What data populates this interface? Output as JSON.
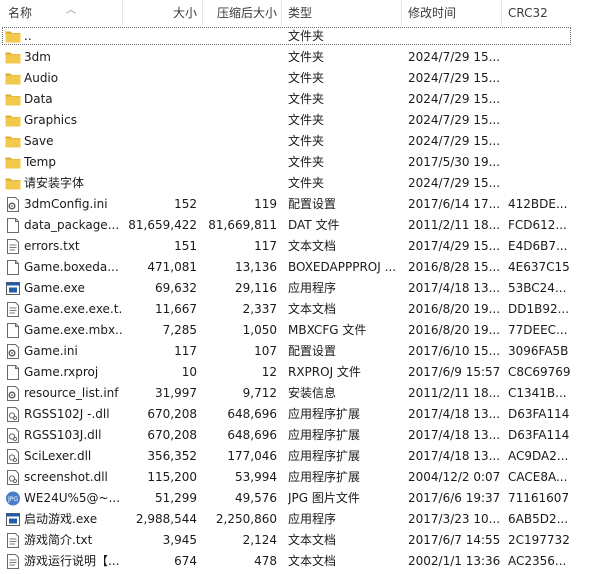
{
  "columns": {
    "name": "名称",
    "size": "大小",
    "compressed": "压缩后大小",
    "type": "类型",
    "modified": "修改时间",
    "crc": "CRC32"
  },
  "rows": [
    {
      "name": "..",
      "size": "",
      "csize": "",
      "type": "文件夹",
      "mod": "",
      "crc": "",
      "icon": "folder-icon"
    },
    {
      "name": "3dm",
      "size": "",
      "csize": "",
      "type": "文件夹",
      "mod": "2024/7/29 15...",
      "crc": "",
      "icon": "folder-icon"
    },
    {
      "name": "Audio",
      "size": "",
      "csize": "",
      "type": "文件夹",
      "mod": "2024/7/29 15...",
      "crc": "",
      "icon": "folder-icon"
    },
    {
      "name": "Data",
      "size": "",
      "csize": "",
      "type": "文件夹",
      "mod": "2024/7/29 15...",
      "crc": "",
      "icon": "folder-icon"
    },
    {
      "name": "Graphics",
      "size": "",
      "csize": "",
      "type": "文件夹",
      "mod": "2024/7/29 15...",
      "crc": "",
      "icon": "folder-icon"
    },
    {
      "name": "Save",
      "size": "",
      "csize": "",
      "type": "文件夹",
      "mod": "2024/7/29 15...",
      "crc": "",
      "icon": "folder-icon"
    },
    {
      "name": "Temp",
      "size": "",
      "csize": "",
      "type": "文件夹",
      "mod": "2017/5/30 19...",
      "crc": "",
      "icon": "folder-icon"
    },
    {
      "name": "请安装字体",
      "size": "",
      "csize": "",
      "type": "文件夹",
      "mod": "2024/7/29 15...",
      "crc": "",
      "icon": "folder-icon"
    },
    {
      "name": "3dmConfig.ini",
      "size": "152",
      "csize": "119",
      "type": "配置设置",
      "mod": "2017/6/14 17...",
      "crc": "412BDE...",
      "icon": "settings-file-icon"
    },
    {
      "name": "data_package...",
      "size": "81,659,422",
      "csize": "81,669,811",
      "type": "DAT 文件",
      "mod": "2011/2/11 18...",
      "crc": "FCD612...",
      "icon": "file-icon"
    },
    {
      "name": "errors.txt",
      "size": "151",
      "csize": "117",
      "type": "文本文档",
      "mod": "2017/4/29 15...",
      "crc": "E4D6B7...",
      "icon": "text-file-icon"
    },
    {
      "name": "Game.boxeda...",
      "size": "471,081",
      "csize": "13,136",
      "type": "BOXEDAPPPROJ ...",
      "mod": "2016/8/28 15...",
      "crc": "4E637C15",
      "icon": "file-icon"
    },
    {
      "name": "Game.exe",
      "size": "69,632",
      "csize": "29,116",
      "type": "应用程序",
      "mod": "2017/4/18 13...",
      "crc": "53BC24...",
      "icon": "exe-icon"
    },
    {
      "name": "Game.exe.exe.t...",
      "size": "11,667",
      "csize": "2,337",
      "type": "文本文档",
      "mod": "2016/8/20 19...",
      "crc": "DD1B92...",
      "icon": "text-file-icon"
    },
    {
      "name": "Game.exe.mbx...",
      "size": "7,285",
      "csize": "1,050",
      "type": "MBXCFG 文件",
      "mod": "2016/8/20 19...",
      "crc": "77DEEC...",
      "icon": "file-icon"
    },
    {
      "name": "Game.ini",
      "size": "117",
      "csize": "107",
      "type": "配置设置",
      "mod": "2017/6/10 15...",
      "crc": "3096FA5B",
      "icon": "settings-file-icon"
    },
    {
      "name": "Game.rxproj",
      "size": "10",
      "csize": "12",
      "type": "RXPROJ 文件",
      "mod": "2017/6/9 15:57",
      "crc": "C8C69769",
      "icon": "file-icon"
    },
    {
      "name": "resource_list.inf",
      "size": "31,997",
      "csize": "9,712",
      "type": "安装信息",
      "mod": "2011/2/11 18...",
      "crc": "C1341B...",
      "icon": "settings-file-icon"
    },
    {
      "name": "RGSS102J -.dll",
      "size": "670,208",
      "csize": "648,696",
      "type": "应用程序扩展",
      "mod": "2017/4/18 13...",
      "crc": "D63FA114",
      "icon": "dll-icon"
    },
    {
      "name": "RGSS103J.dll",
      "size": "670,208",
      "csize": "648,696",
      "type": "应用程序扩展",
      "mod": "2017/4/18 13...",
      "crc": "D63FA114",
      "icon": "dll-icon"
    },
    {
      "name": "SciLexer.dll",
      "size": "356,352",
      "csize": "177,046",
      "type": "应用程序扩展",
      "mod": "2017/4/18 13...",
      "crc": "AC9DA2...",
      "icon": "dll-icon"
    },
    {
      "name": "screenshot.dll",
      "size": "115,200",
      "csize": "53,994",
      "type": "应用程序扩展",
      "mod": "2004/12/2 0:07",
      "crc": "CACE8A...",
      "icon": "dll-icon"
    },
    {
      "name": "WE24U%5@~...",
      "size": "51,299",
      "csize": "49,576",
      "type": "JPG 图片文件",
      "mod": "2017/6/6 19:37",
      "crc": "71161607",
      "icon": "jpg-icon"
    },
    {
      "name": "启动游戏.exe",
      "size": "2,988,544",
      "csize": "2,250,860",
      "type": "应用程序",
      "mod": "2017/3/23 10...",
      "crc": "6AB5D2...",
      "icon": "exe-icon"
    },
    {
      "name": "游戏简介.txt",
      "size": "3,945",
      "csize": "2,124",
      "type": "文本文档",
      "mod": "2017/6/7 14:55",
      "crc": "2C197732",
      "icon": "text-file-icon"
    },
    {
      "name": "游戏运行说明【...",
      "size": "674",
      "csize": "478",
      "type": "文本文档",
      "mod": "2002/1/1 13:36",
      "crc": "AC2356...",
      "icon": "text-file-icon"
    }
  ],
  "colors": {
    "folder": "#f2c94c",
    "folder_dark": "#dcaa2e",
    "exe_blue": "#1f5fa8",
    "header_text": "#3b3b3b"
  }
}
